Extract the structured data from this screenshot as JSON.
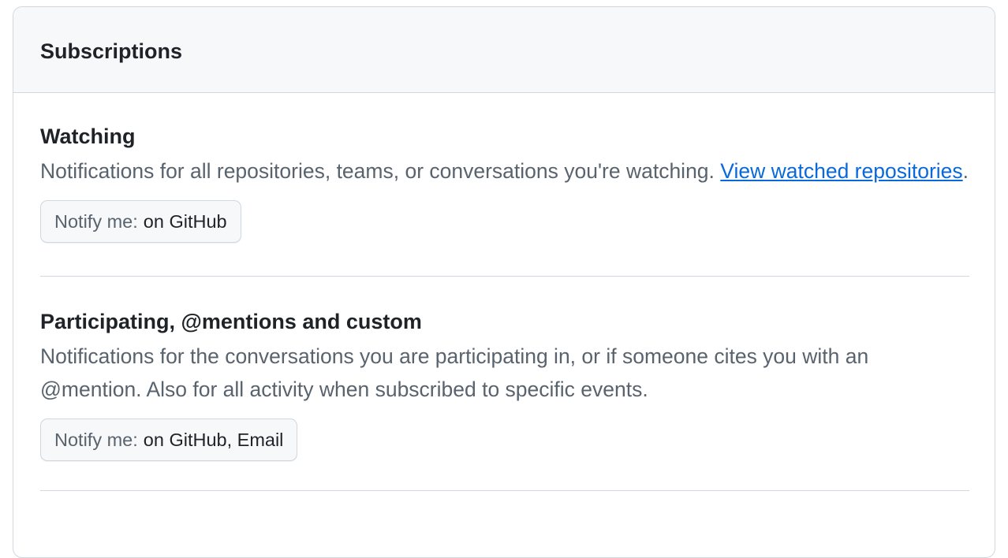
{
  "panel": {
    "title": "Subscriptions"
  },
  "sections": [
    {
      "heading": "Watching",
      "description": "Notifications for all repositories, teams, or conversations you're watching. ",
      "link_text": "View watched repositories",
      "trailing": ".",
      "notify_label": "Notify me:",
      "notify_value": "on GitHub"
    },
    {
      "heading": "Participating, @mentions and custom",
      "description": "Notifications for the conversations you are participating in, or if someone cites you with an @mention. Also for all activity when subscribed to specific events.",
      "notify_label": "Notify me:",
      "notify_value": "on GitHub, Email"
    }
  ],
  "colors": {
    "header_bg": "#f6f8fa",
    "border": "#d0d7de",
    "text": "#1f2328",
    "muted": "#59636e",
    "link": "#0969da"
  }
}
